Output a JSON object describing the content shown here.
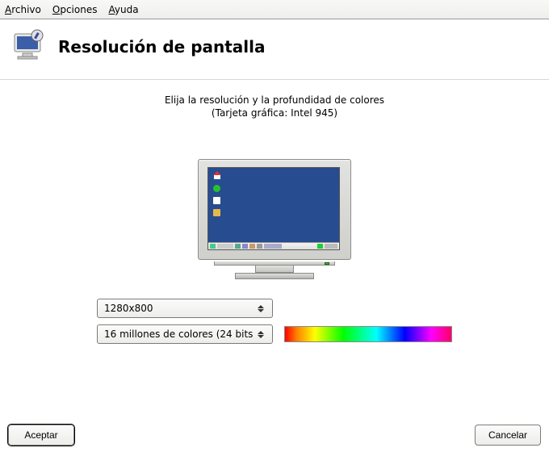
{
  "menu": {
    "file": "Archivo",
    "options": "Opciones",
    "help": "Ayuda"
  },
  "header": {
    "title": "Resolución de pantalla"
  },
  "content": {
    "instruction": "Elija la resolución y la profundidad de colores",
    "card_info": "(Tarjeta gráfica: Intel 945)"
  },
  "controls": {
    "resolution": {
      "selected": "1280x800"
    },
    "color_depth": {
      "selected": "16 millones de colores (24 bits"
    }
  },
  "buttons": {
    "ok": "Aceptar",
    "cancel": "Cancelar"
  }
}
